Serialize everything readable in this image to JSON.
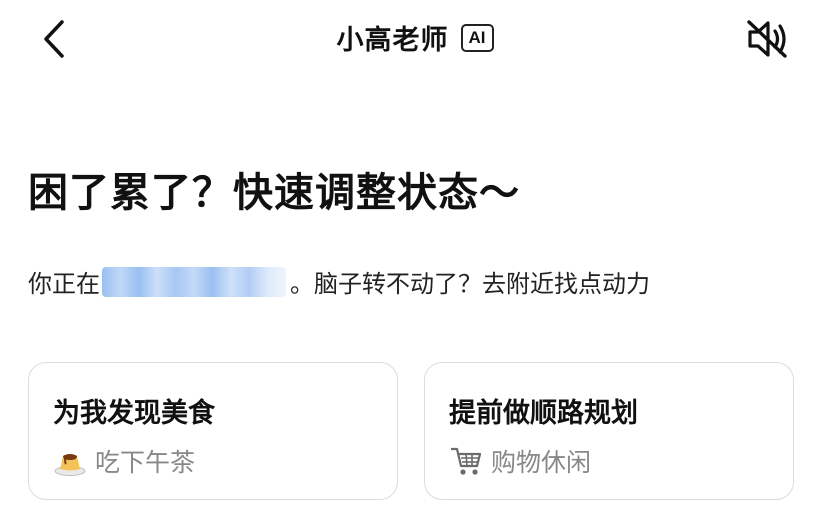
{
  "header": {
    "title": "小高老师",
    "badge": "AI",
    "back_icon": "chevron-left-icon",
    "mute_icon": "speaker-muted-icon"
  },
  "main": {
    "headline": "困了累了？快速调整状态～",
    "subline_prefix": "你正在",
    "subline_suffix": "。脑子转不动了？去附近找点动力"
  },
  "cards": [
    {
      "title": "为我发现美食",
      "sub_label": "吃下午茶",
      "icon": "pudding-icon"
    },
    {
      "title": "提前做顺路规划",
      "sub_label": "购物休闲",
      "icon": "shopping-cart-icon"
    }
  ],
  "colors": {
    "text_primary": "#111111",
    "text_secondary": "#888888",
    "card_border": "#dcdcdc",
    "blur_blue": "#8fb8f0"
  }
}
